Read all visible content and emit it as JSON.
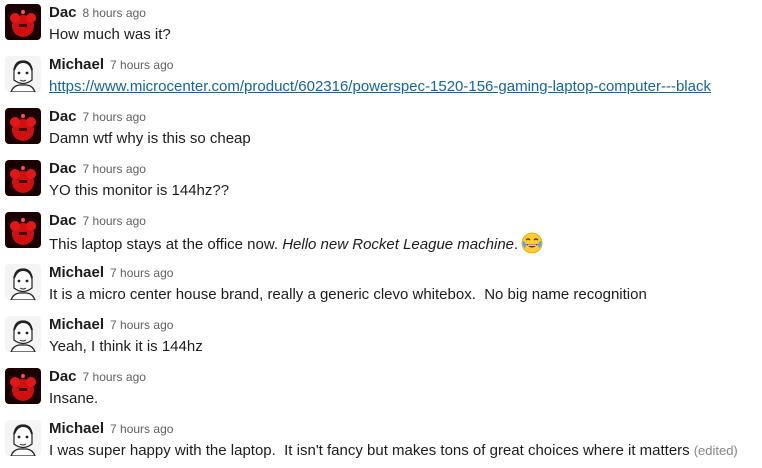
{
  "messages": [
    {
      "author": "Dac",
      "time": "8 hours ago",
      "text": "How much was it?"
    },
    {
      "author": "Michael",
      "time": "7 hours ago",
      "link": "https://www.microcenter.com/product/602316/powerspec-1520-156-gaming-laptop-computer---black"
    },
    {
      "author": "Dac",
      "time": "7 hours ago",
      "text": "Damn wtf why is this so cheap"
    },
    {
      "author": "Dac",
      "time": "7 hours ago",
      "text": "YO this monitor is 144hz??"
    },
    {
      "author": "Dac",
      "time": "7 hours ago",
      "text": "This laptop stays at the office now. ",
      "italic": "Hello new Rocket League machine",
      "after": ".",
      "emoji": "joy-emoji"
    },
    {
      "author": "Michael",
      "time": "7 hours ago",
      "text": "It is a micro center house brand, really a generic clevo whitebox.  No big name recognition"
    },
    {
      "author": "Michael",
      "time": "7 hours ago",
      "text": "Yeah, I think it is 144hz"
    },
    {
      "author": "Dac",
      "time": "7 hours ago",
      "text": "Insane."
    },
    {
      "author": "Michael",
      "time": "7 hours ago",
      "text": "I was super happy with the laptop.  It isn't fancy but makes tons of great choices where it matters",
      "edited": "(edited)"
    }
  ]
}
